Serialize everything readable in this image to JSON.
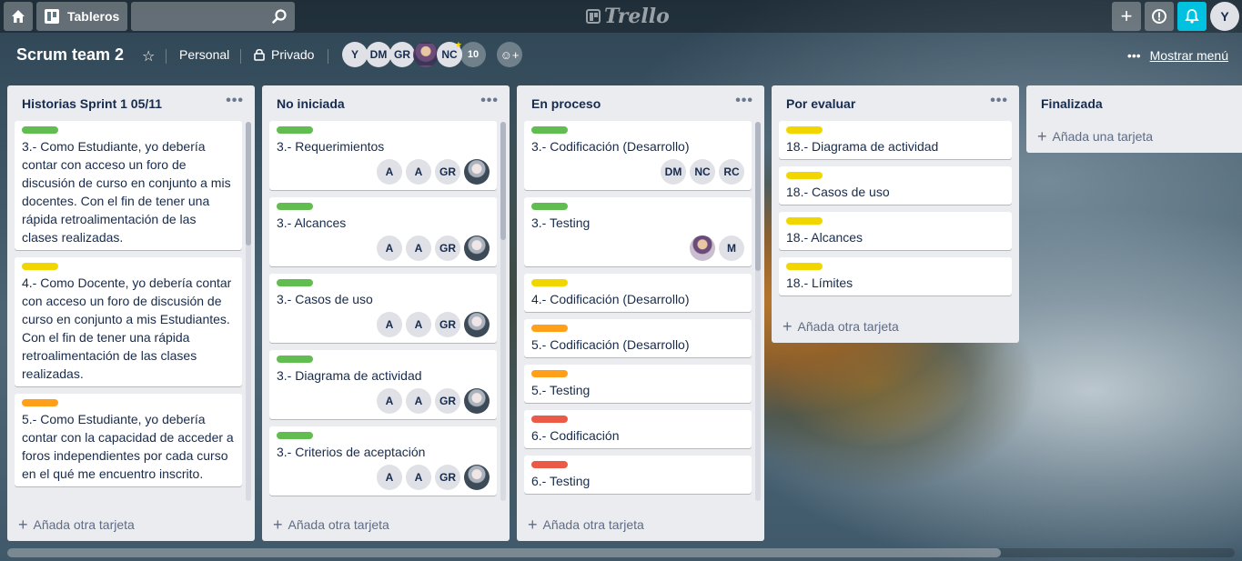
{
  "header": {
    "boards_label": "Tableros",
    "search_placeholder": "",
    "logo_text": "Trello",
    "user_initial": "Y"
  },
  "board": {
    "title": "Scrum team 2",
    "team": "Personal",
    "visibility": "Privado",
    "members": [
      "Y",
      "DM",
      "GR",
      "",
      "NC"
    ],
    "members_more": "10",
    "show_menu": "Mostrar menú"
  },
  "colors": {
    "green": "#61bd4f",
    "yellow": "#f2d600",
    "orange": "#ff9f1a",
    "red": "#eb5a46",
    "notification": "#00c2e0"
  },
  "lists": [
    {
      "title": "Historias Sprint 1 05/11",
      "add_label": "Añada otra tarjeta",
      "cards": [
        {
          "label": "green",
          "title": "3.- Como Estudiante, yo debería contar con acceso un foro de discusión de curso en conjunto a mis docentes. Con el fin de tener una rápida retroalimentación de las clases realizadas.",
          "members": []
        },
        {
          "label": "yellow",
          "title": "4.- Como Docente, yo debería contar con acceso un foro de discusión de curso en conjunto a mis Estudiantes. Con el fin de tener una rápida retroalimentación de las clases realizadas.",
          "members": []
        },
        {
          "label": "orange",
          "title": "5.- Como Estudiante, yo debería contar con la capacidad de acceder a foros independientes por cada curso en el qué me encuentro inscrito.",
          "members": []
        }
      ]
    },
    {
      "title": "No iniciada",
      "add_label": "Añada otra tarjeta",
      "cards": [
        {
          "label": "green",
          "title": "3.- Requerimientos",
          "members": [
            "A",
            "A",
            "GR",
            "photo"
          ]
        },
        {
          "label": "green",
          "title": "3.- Alcances",
          "members": [
            "A",
            "A",
            "GR",
            "photo"
          ]
        },
        {
          "label": "green",
          "title": "3.- Casos de uso",
          "members": [
            "A",
            "A",
            "GR",
            "photo"
          ]
        },
        {
          "label": "green",
          "title": "3.- Diagrama de actividad",
          "members": [
            "A",
            "A",
            "GR",
            "photo"
          ]
        },
        {
          "label": "green",
          "title": "3.- Criterios de aceptación",
          "members": [
            "A",
            "A",
            "GR",
            "photo"
          ]
        }
      ]
    },
    {
      "title": "En proceso",
      "add_label": "Añada otra tarjeta",
      "cards": [
        {
          "label": "green",
          "title": "3.- Codificación (Desarrollo)",
          "members": [
            "DM",
            "NC",
            "RC"
          ]
        },
        {
          "label": "green",
          "title": "3.- Testing",
          "members": [
            "photo2",
            "M"
          ]
        },
        {
          "label": "yellow",
          "title": "4.- Codificación (Desarrollo)",
          "members": []
        },
        {
          "label": "orange",
          "title": "5.- Codificación (Desarrollo)",
          "members": []
        },
        {
          "label": "orange",
          "title": "5.- Testing",
          "members": []
        },
        {
          "label": "red",
          "title": "6.- Codificación",
          "members": []
        },
        {
          "label": "red",
          "title": "6.- Testing",
          "members": []
        }
      ]
    },
    {
      "title": "Por evaluar",
      "add_label": "Añada otra tarjeta",
      "cards": [
        {
          "label": "yellow",
          "title": "18.- Diagrama de actividad",
          "members": []
        },
        {
          "label": "yellow",
          "title": "18.- Casos de uso",
          "members": []
        },
        {
          "label": "yellow",
          "title": "18.- Alcances",
          "members": []
        },
        {
          "label": "yellow",
          "title": "18.- Límites",
          "members": []
        }
      ]
    },
    {
      "title": "Finalizada",
      "add_label": "Añada una tarjeta",
      "cards": []
    }
  ]
}
